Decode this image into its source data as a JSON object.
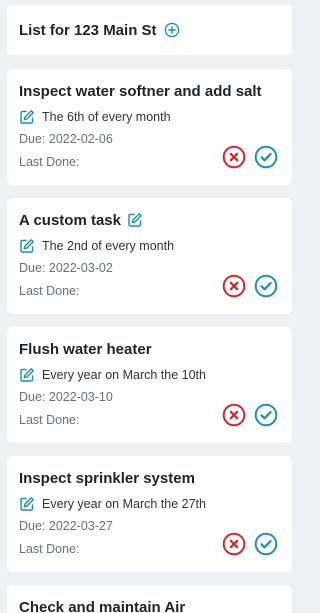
{
  "header": {
    "title": "List for 123 Main St"
  },
  "labels": {
    "due_prefix": "Due:",
    "last_done": "Last Done:"
  },
  "colors": {
    "accent": "#1a8fb0",
    "danger": "#d9232b",
    "edit": "#1a8fb0"
  },
  "icons": {
    "add": "plus-circle-icon",
    "edit": "edit-icon",
    "dismiss": "x-circle-icon",
    "complete": "check-circle-icon"
  },
  "tasks": [
    {
      "title": "Inspect water softner and add salt",
      "schedule": "The 6th of every month",
      "due": "Due: 2022-02-06",
      "last_done": "Last Done:"
    },
    {
      "title": "A custom task",
      "schedule": "The 2nd of every month",
      "due": "Due: 2022-03-02",
      "last_done": "Last Done:"
    },
    {
      "title": "Flush water heater",
      "schedule": "Every year on March the 10th",
      "due": "Due: 2022-03-10",
      "last_done": "Last Done:"
    },
    {
      "title": "Inspect sprinkler system",
      "schedule": "Every year on March the 27th",
      "due": "Due: 2022-03-27",
      "last_done": "Last Done:"
    },
    {
      "title": "Check and maintain Air"
    }
  ]
}
